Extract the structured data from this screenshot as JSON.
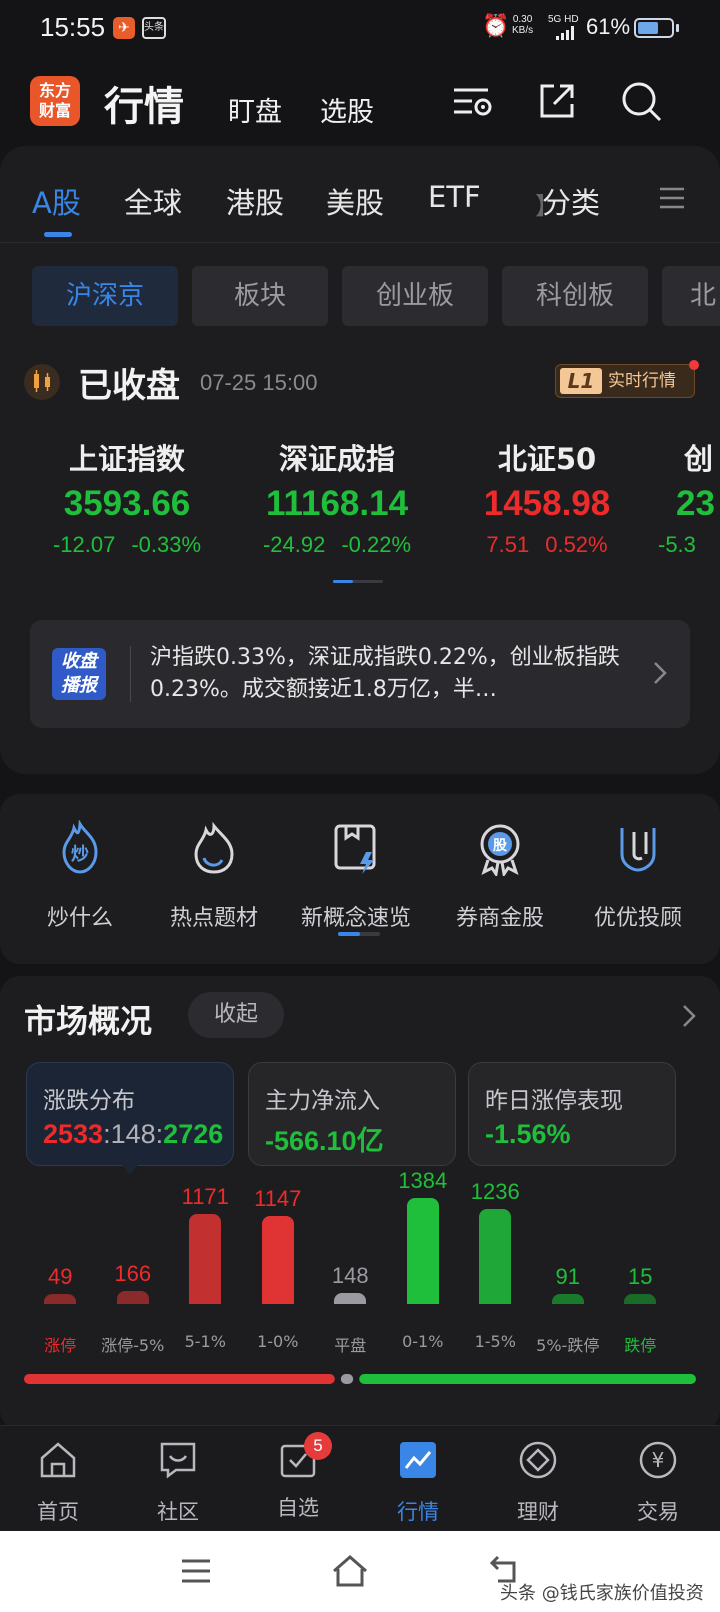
{
  "status_bar": {
    "time": "15:55",
    "app1_glyph": "✈",
    "app2_label": "头条",
    "net_speed": "0.30",
    "net_unit": "KB/s",
    "signal_label": "5G HD",
    "battery": "61%",
    "battery_level": 0.61
  },
  "header": {
    "logo_line1": "东方",
    "logo_line2": "财富",
    "title": "行情",
    "link_watch": "盯盘",
    "link_pick": "选股",
    "icons": [
      "settings-list-icon",
      "share-icon",
      "search-icon"
    ]
  },
  "tabs": {
    "items": [
      "A股",
      "全球",
      "港股",
      "美股",
      "ETF",
      "分类"
    ],
    "faded": "】",
    "active": "A股"
  },
  "subtabs": {
    "items": [
      "沪深京",
      "板块",
      "创业板",
      "科创板",
      "北"
    ],
    "active": "沪深京"
  },
  "market_status": {
    "title": "已收盘",
    "time": "07-25 15:00",
    "badge_tag": "L1",
    "badge_text": "实时行情"
  },
  "indices": [
    {
      "name": "上证指数",
      "value": "3593.66",
      "change": "-12.07",
      "pct": "-0.33%",
      "dir": "down"
    },
    {
      "name": "深证成指",
      "value": "11168.14",
      "change": "-24.92",
      "pct": "-0.22%",
      "dir": "down"
    },
    {
      "name": "北证50",
      "value": "1458.98",
      "change": "7.51",
      "pct": "0.52%",
      "dir": "up"
    },
    {
      "name": "创",
      "value": "23",
      "change": "-5.3",
      "pct": "",
      "dir": "down"
    }
  ],
  "broadcast": {
    "badge_line1": "收盘",
    "badge_line2": "播报",
    "text": "沪指跌0.33%，深证成指跌0.22%，创业板指跌0.23%。成交额接近1.8万亿，半…"
  },
  "shortcuts": [
    {
      "label": "炒什么",
      "icon": "fire-chao-icon",
      "glyph": "炒"
    },
    {
      "label": "热点题材",
      "icon": "flame-icon",
      "glyph": ""
    },
    {
      "label": "新概念速览",
      "icon": "new-concept-icon",
      "glyph": ""
    },
    {
      "label": "券商金股",
      "icon": "gold-stock-icon",
      "glyph": "股"
    },
    {
      "label": "优优投顾",
      "icon": "advisor-icon",
      "glyph": ""
    }
  ],
  "market_overview": {
    "title": "市场概况",
    "collapse_label": "收起",
    "boxes": [
      {
        "label": "涨跌分布",
        "up": "2533",
        "flat": "148",
        "down": "2726",
        "sep": ":"
      },
      {
        "label": "主力净流入",
        "value": "-566.10亿"
      },
      {
        "label": "昨日涨停表现",
        "value": "-1.56%"
      }
    ]
  },
  "chart_data": {
    "type": "bar",
    "categories": [
      "涨停",
      "涨停-5%",
      "5-1%",
      "1-0%",
      "平盘",
      "0-1%",
      "1-5%",
      "5%-跌停",
      "跌停"
    ],
    "values": [
      49,
      166,
      1171,
      1147,
      148,
      1384,
      1236,
      91,
      15
    ],
    "colors": [
      "#8a2a2a",
      "#8a2a2a",
      "#c23030",
      "#e03434",
      "#9a9aa0",
      "#1fbf3b",
      "#1fa838",
      "#1a7a2c",
      "#1a6a28"
    ],
    "label_colors": [
      "red",
      "red",
      "red",
      "red",
      "gray",
      "green",
      "green",
      "green",
      "green"
    ],
    "up_total": 2533,
    "flat_total": 148,
    "down_total": 2726
  },
  "bottom_nav": {
    "items": [
      {
        "label": "首页",
        "icon": "home-icon"
      },
      {
        "label": "社区",
        "icon": "community-icon"
      },
      {
        "label": "自选",
        "icon": "watchlist-icon",
        "badge": "5"
      },
      {
        "label": "行情",
        "icon": "market-icon",
        "active": true
      },
      {
        "label": "理财",
        "icon": "wealth-icon"
      },
      {
        "label": "交易",
        "icon": "trade-icon"
      }
    ]
  },
  "system_nav": {
    "watermark": "头条 @钱氏家族价值投资"
  },
  "colors": {
    "accent": "#3a86e6",
    "up": "#ee2b2b",
    "down": "#1fbf3b",
    "background": "#141416",
    "card": "#1d1d20"
  }
}
